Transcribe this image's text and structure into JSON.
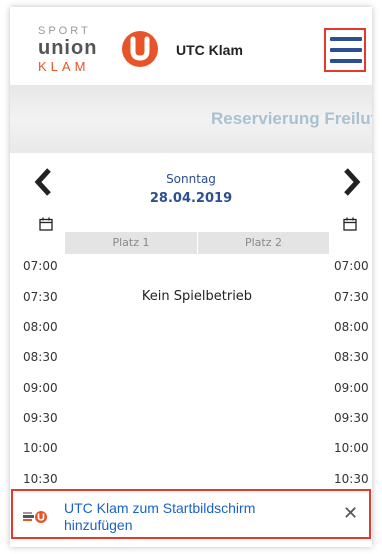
{
  "header": {
    "logo_line1": "SPORT",
    "logo_line2": "union",
    "logo_line3": "KLAM",
    "club_name": "UTC Klam",
    "menu_icon": "hamburger-menu-icon"
  },
  "banner": {
    "title": "Reservierung Freiluft"
  },
  "date_nav": {
    "day": "Sonntag",
    "date": "28.04.2019",
    "prev_icon": "chevron-left-icon",
    "next_icon": "chevron-right-icon",
    "calendar_icon": "calendar-icon"
  },
  "courts": [
    "Platz 1",
    "Platz 2"
  ],
  "times": [
    "07:00",
    "07:30",
    "08:00",
    "08:30",
    "09:00",
    "09:30",
    "10:00",
    "10:30"
  ],
  "status_text": "Kein Spielbetrieb",
  "add_to_home": {
    "text": "UTC Klam zum Startbildschirm hinzufügen",
    "close_icon": "close-icon"
  },
  "colors": {
    "brand_orange": "#e8542a",
    "brand_blue": "#2b4f91",
    "highlight_red": "#e53a2a",
    "link_blue": "#1a63c9",
    "banner_title": "#a9c1d2"
  }
}
